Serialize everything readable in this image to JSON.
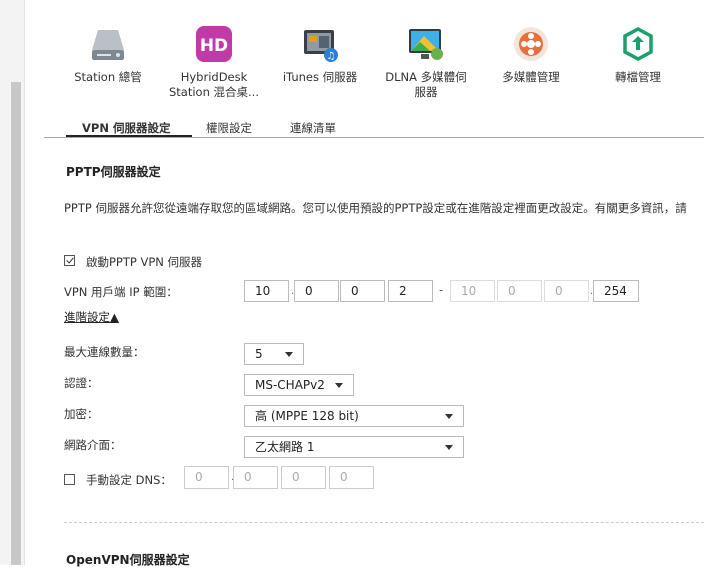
{
  "apps": [
    {
      "label": "Station 總管",
      "icon": "station-manager-icon"
    },
    {
      "label": "HybridDesk Station 混合桌...",
      "icon": "hybriddesk-icon"
    },
    {
      "label": "iTunes 伺服器",
      "icon": "itunes-server-icon"
    },
    {
      "label": "DLNA 多媒體伺服器",
      "icon": "dlna-server-icon"
    },
    {
      "label": "多媒體管理",
      "icon": "multimedia-icon"
    },
    {
      "label": "轉檔管理",
      "icon": "transcode-icon"
    }
  ],
  "tabs": [
    {
      "label": "VPN 伺服器設定",
      "active": true
    },
    {
      "label": "權限設定",
      "active": false
    },
    {
      "label": "連線清單",
      "active": false
    }
  ],
  "pptp": {
    "title": "PPTP伺服器設定",
    "description": "PPTP 伺服器允許您從遠端存取您的區域網路。您可以使用預設的PPTP設定或在進階設定裡面更改設定。有關更多資訊，請",
    "enable_label": "啟動PPTP VPN 伺服器",
    "enable_checked": true,
    "ip_range_label": "VPN 用戶端 IP 範圍：",
    "ip_start": [
      "10",
      "0",
      "0",
      "2"
    ],
    "ip_end": [
      "10",
      "0",
      "0",
      "254"
    ],
    "range_separator": "-",
    "advanced_link": "進階設定▲",
    "max_conn_label": "最大連線數量：",
    "max_conn_value": "5",
    "auth_label": "認證：",
    "auth_value": "MS-CHAPv2",
    "enc_label": "加密：",
    "enc_value": "高 (MPPE 128 bit)",
    "nic_label": "網路介面：",
    "nic_value": "乙太網路 1",
    "dns_label": "手動設定 DNS：",
    "dns_checked": false,
    "dns_values": [
      "0",
      "0",
      "0",
      "0"
    ]
  },
  "openvpn": {
    "title": "OpenVPN伺服器設定"
  },
  "colors": {
    "hybriddesk": "#c03aa8",
    "transcode": "#1aa06a",
    "multimedia": "#e8703a"
  }
}
